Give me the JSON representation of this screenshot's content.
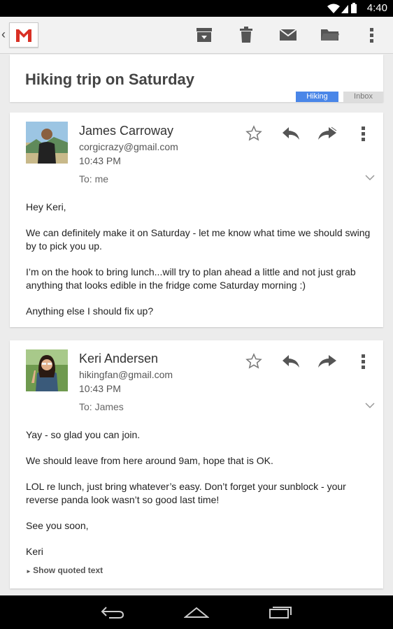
{
  "status": {
    "time": "4:40"
  },
  "conversation": {
    "subject": "Hiking trip on Saturday",
    "labels": [
      {
        "text": "Hiking",
        "color": "#4a86e8"
      },
      {
        "text": "Inbox",
        "color": "#dddddd"
      }
    ]
  },
  "messages": [
    {
      "sender": "James Carroway",
      "email": "corgicrazy@gmail.com",
      "time": "10:43 PM",
      "to": "To: me",
      "paragraphs": [
        "Hey Keri,",
        "We can definitely make it on Saturday - let me know what time we should swing by to pick you up.",
        "I’m on the hook to bring lunch...will try to plan ahead a little and not just grab anything that looks edible in the fridge come Saturday morning :)",
        "Anything else I should fix up?"
      ]
    },
    {
      "sender": "Keri Andersen",
      "email": "hikingfan@gmail.com",
      "time": "10:43 PM",
      "to": "To: James",
      "paragraphs": [
        "Yay - so glad you can join.",
        "We should leave from here around 9am, hope that is OK.",
        "LOL re lunch, just bring whatever’s easy. Don’t forget your sunblock - your reverse panda look wasn’t so good last time!",
        "See you soon,",
        "Keri"
      ],
      "show_quoted": "Show quoted text"
    }
  ],
  "icons": {
    "actionbar": [
      "archive-icon",
      "trash-icon",
      "mark-unread-icon",
      "move-to-folder-icon",
      "overflow-menu-icon"
    ],
    "message": [
      "star-icon",
      "reply-icon",
      "forward-icon",
      "overflow-menu-icon",
      "chevron-down-icon"
    ],
    "navbar": [
      "back-icon",
      "home-icon",
      "recent-apps-icon"
    ]
  },
  "colors": {
    "accent_label": "#4a86e8",
    "gmail_red": "#d93025"
  }
}
